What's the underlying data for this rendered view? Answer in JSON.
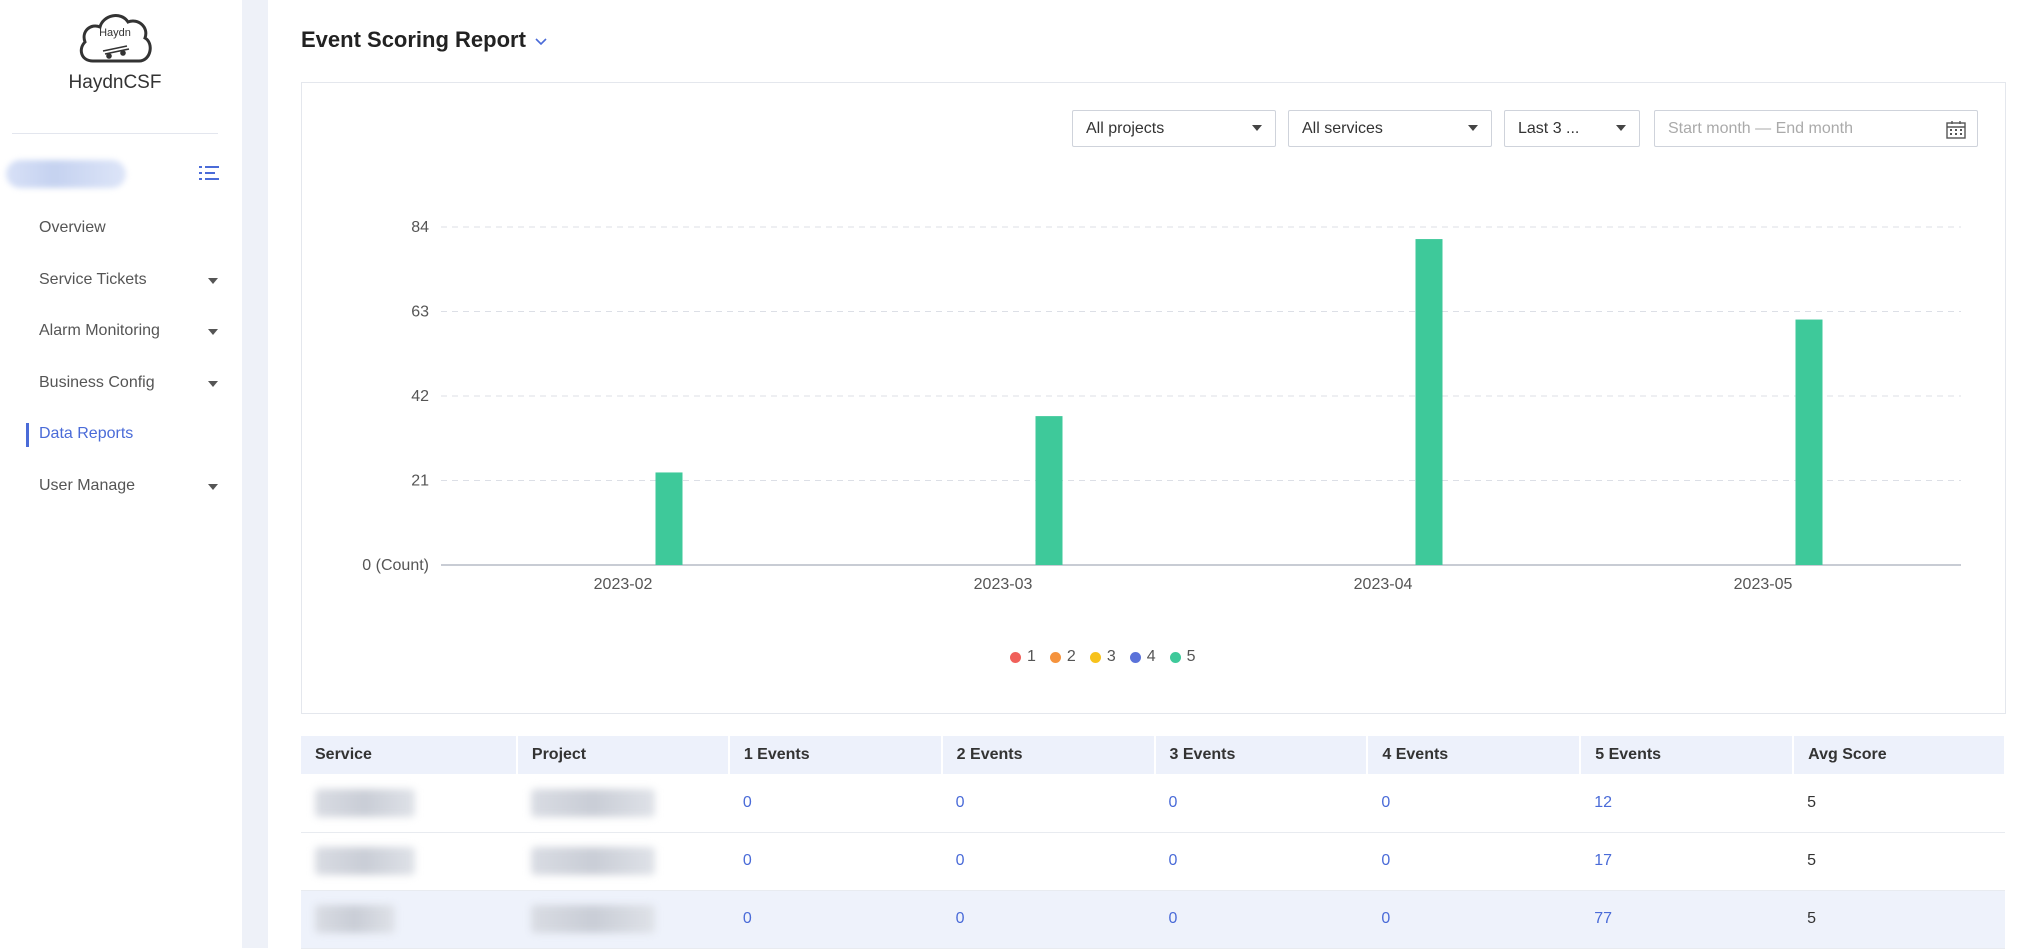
{
  "app": {
    "logo_text": "Haydn",
    "brand": "HaydnCSF"
  },
  "sidebar": {
    "items": [
      {
        "label": "Overview",
        "has_caret": false,
        "active": false
      },
      {
        "label": "Service Tickets",
        "has_caret": true,
        "active": false
      },
      {
        "label": "Alarm Monitoring",
        "has_caret": true,
        "active": false
      },
      {
        "label": "Business Config",
        "has_caret": true,
        "active": false
      },
      {
        "label": "Data Reports",
        "has_caret": false,
        "active": true
      },
      {
        "label": "User Manage",
        "has_caret": true,
        "active": false
      }
    ]
  },
  "header": {
    "title": "Event Scoring Report"
  },
  "filters": {
    "projects": "All projects",
    "services": "All services",
    "period": "Last 3 ...",
    "date_placeholder": "Start month — End month"
  },
  "colors": {
    "accent": "#4a6bd8",
    "bar": "#3ec99a"
  },
  "chart_data": {
    "type": "bar",
    "categories": [
      "2023-02",
      "2023-03",
      "2023-04",
      "2023-05"
    ],
    "series": [
      {
        "name": "1",
        "color": "#f0605a",
        "values": [
          0,
          0,
          0,
          0
        ]
      },
      {
        "name": "2",
        "color": "#f5933d",
        "values": [
          0,
          0,
          0,
          0
        ]
      },
      {
        "name": "3",
        "color": "#f7c21c",
        "values": [
          0,
          0,
          0,
          0
        ]
      },
      {
        "name": "4",
        "color": "#5a72d9",
        "values": [
          0,
          0,
          0,
          0
        ]
      },
      {
        "name": "5",
        "color": "#3ec99a",
        "values": [
          23,
          37,
          81,
          61
        ]
      }
    ],
    "y_ticks": [
      "0 (Count)",
      "21",
      "42",
      "63",
      "84"
    ],
    "ylim": [
      0,
      84
    ],
    "grid": true,
    "legend_position": "bottom-center"
  },
  "table": {
    "headers": [
      "Service",
      "Project",
      "1 Events",
      "2 Events",
      "3 Events",
      "4 Events",
      "5 Events",
      "Avg Score"
    ],
    "rows": [
      {
        "e1": "0",
        "e2": "0",
        "e3": "0",
        "e4": "0",
        "e5": "12",
        "avg": "5"
      },
      {
        "e1": "0",
        "e2": "0",
        "e3": "0",
        "e4": "0",
        "e5": "17",
        "avg": "5"
      },
      {
        "e1": "0",
        "e2": "0",
        "e3": "0",
        "e4": "0",
        "e5": "77",
        "avg": "5"
      }
    ]
  }
}
